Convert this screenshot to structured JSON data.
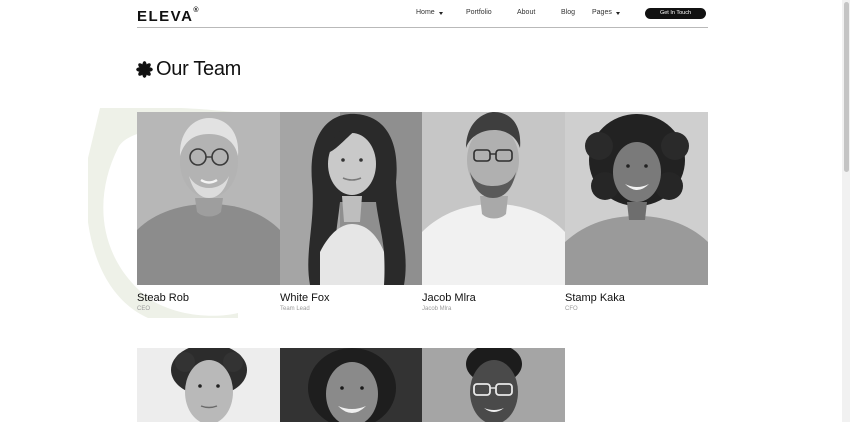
{
  "header": {
    "logo": "ELEVA",
    "logo_mark": "®",
    "nav": [
      {
        "label": "Home",
        "has_dropdown": true
      },
      {
        "label": "Portfolio",
        "has_dropdown": false
      },
      {
        "label": "About",
        "has_dropdown": false
      },
      {
        "label": "Blog",
        "has_dropdown": false
      },
      {
        "label": "Pages",
        "has_dropdown": true
      }
    ],
    "cta_label": "Get In Touch"
  },
  "section": {
    "title": "Our Team",
    "title_icon": "asterisk-flower-icon"
  },
  "team": [
    {
      "name": "Steab Rob",
      "role": "CEO",
      "photo": "portrait-older-man-glasses-sweater"
    },
    {
      "name": "White Fox",
      "role": "Team Lead",
      "photo": "portrait-woman-long-wavy-hair"
    },
    {
      "name": "Jacob Mlra",
      "role": "Jacob Mlra",
      "photo": "portrait-man-glasses-beard"
    },
    {
      "name": "Stamp Kaka",
      "role": "CFO",
      "photo": "portrait-woman-curly-hair-smiling"
    },
    {
      "name": "",
      "role": "",
      "photo": "portrait-young-man-curly-hair"
    },
    {
      "name": "",
      "role": "",
      "photo": "portrait-woman-smiling-dark-background"
    },
    {
      "name": "",
      "role": "",
      "photo": "portrait-woman-glasses-short-hair"
    }
  ],
  "colors": {
    "accent": "#111111",
    "divider": "#b9b9b9",
    "muted_text": "#9a9a9a",
    "watermark": "#eef1e8"
  }
}
